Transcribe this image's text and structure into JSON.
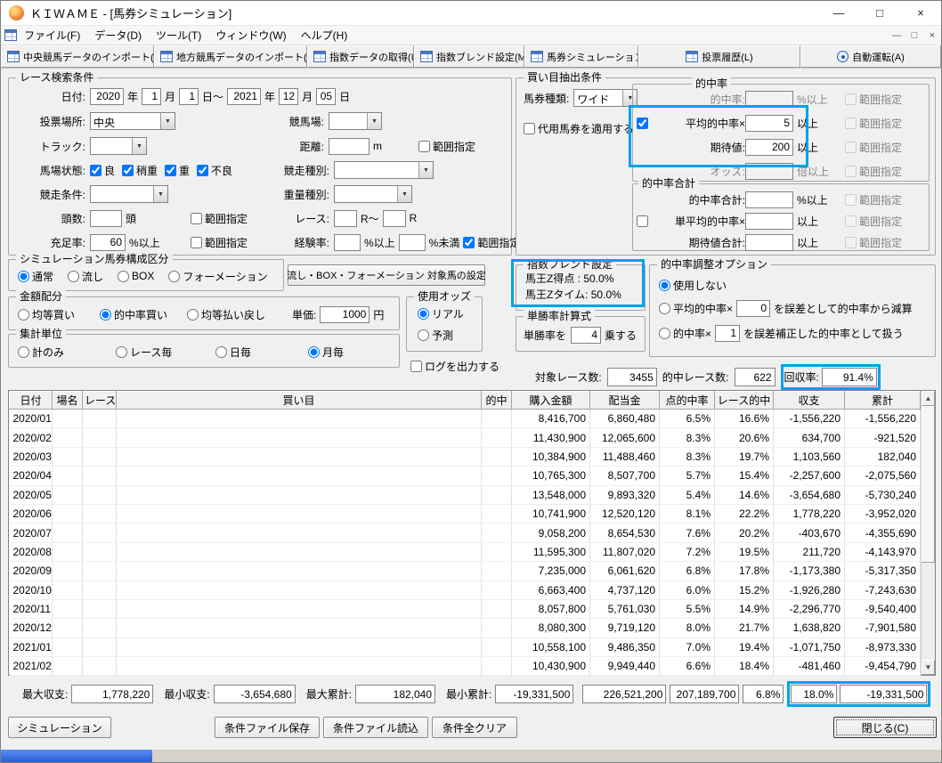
{
  "colors": {
    "annotation": "#00a2e8"
  },
  "icons": {
    "combo_arrow": "▼",
    "scroll_up": "▲",
    "scroll_down": "▼"
  },
  "titlebar": {
    "title": "ＫＩＷＡＭＥ - [馬券シミュレーション]",
    "minimize": "—",
    "maximize": "□",
    "close": "×"
  },
  "menubar": {
    "items": [
      "ファイル(F)",
      "データ(D)",
      "ツール(T)",
      "ウィンドウ(W)",
      "ヘルプ(H)"
    ],
    "mdi_minimize": "—",
    "mdi_restore": "□",
    "mdi_close": "×"
  },
  "toolbar": {
    "buttons": [
      "中央競馬データのインポート(J)",
      "地方競馬データのインポート(N)",
      "指数データの取得(I)",
      "指数ブレンド設定(M)",
      "馬券シミュレーション(B)",
      "投票履歴(L)",
      "自動運転(A)"
    ]
  },
  "race_search": {
    "legend": "レース検索条件",
    "date_label": "日付:",
    "date_from_year": "2020",
    "date_from_month": "1",
    "date_from_day": "1",
    "date_to_year": "2021",
    "date_to_month": "12",
    "date_to_day": "05",
    "unit_year": "年",
    "unit_month": "月",
    "unit_day_tilde": "日～",
    "unit_day": "日",
    "place_label": "投票場所:",
    "place_value": "中央",
    "course_label": "競馬場:",
    "track_label": "トラック:",
    "distance_label": "距離:",
    "distance_unit": "m",
    "ground_label": "馬場状態:",
    "ground_options": [
      {
        "label": "良",
        "checked": true
      },
      {
        "label": "稍重",
        "checked": true
      },
      {
        "label": "重",
        "checked": true
      },
      {
        "label": "不良",
        "checked": true
      }
    ],
    "race_type_label": "競走種別:",
    "race_cond_label": "競走条件:",
    "weight_type_label": "重量種別:",
    "heads_label": "頭数:",
    "heads_unit": "頭",
    "race_label": "レース:",
    "race_unit1": "R～",
    "race_unit2": "R",
    "fill_label": "充足率:",
    "fill_value": "60",
    "fill_unit": "%以上",
    "exp_label": "経験率:",
    "exp_unit1": "%以上",
    "exp_unit2": "%未満",
    "range_label": "範囲指定",
    "range_distance_checked": false,
    "range_heads_checked": false,
    "range_fill_checked": false,
    "range_exp_checked": true
  },
  "extract": {
    "legend": "買い目抽出条件",
    "ticket_label": "馬券種類:",
    "ticket_value": "ワイド",
    "substitute_label": "代用馬券を適用する",
    "substitute_checked": false,
    "range_label": "範囲指定",
    "hit_group_legend": "的中率",
    "hit_rate_label": "的中率:",
    "hit_rate_unit": "%以上",
    "avg_hit_label": "平均的中率×",
    "avg_hit_value": "5",
    "avg_hit_unit": "以上",
    "avg_hit_checked": true,
    "expect_label": "期待値:",
    "expect_value": "200",
    "expect_unit": "以上",
    "odds_label": "オッズ:",
    "odds_unit": "倍以上",
    "total_group_legend": "的中率合計",
    "hit_total_label": "的中率合計:",
    "hit_total_unit": "%以上",
    "avg_single_label": "単平均的中率×",
    "avg_single_unit": "以上",
    "avg_single_checked": false,
    "expect_total_label": "期待値合計:",
    "expect_total_unit": "以上"
  },
  "sim_type": {
    "legend": "シミュレーション馬券構成区分",
    "options": [
      {
        "label": "通常",
        "checked": true
      },
      {
        "label": "流し",
        "checked": false
      },
      {
        "label": "BOX",
        "checked": false
      },
      {
        "label": "フォーメーション",
        "checked": false
      }
    ]
  },
  "target_button_label": "流し・BOX・フォーメーション 対象馬の設定",
  "amount": {
    "legend": "金額配分",
    "options": [
      {
        "label": "均等買い",
        "checked": false
      },
      {
        "label": "的中率買い",
        "checked": true
      },
      {
        "label": "均等払い戻し",
        "checked": false
      }
    ],
    "unit_label": "単価:",
    "unit_value": "1000",
    "unit_suffix": "円"
  },
  "use_odds": {
    "legend": "使用オッズ",
    "options": [
      {
        "label": "リアル",
        "checked": true
      },
      {
        "label": "予測",
        "checked": false
      }
    ]
  },
  "aggregate": {
    "legend": "集計単位",
    "options": [
      {
        "label": "計のみ",
        "checked": false
      },
      {
        "label": "レース毎",
        "checked": false
      },
      {
        "label": "日毎",
        "checked": false
      },
      {
        "label": "月毎",
        "checked": true
      }
    ]
  },
  "log_label": "ログを出力する",
  "log_checked": false,
  "blend": {
    "legend": "指数ブレンド設定",
    "line1": "馬王Z得点 : 50.0%",
    "line2": "馬王Zタイム: 50.0%"
  },
  "win_calc": {
    "legend": "単勝率計算式",
    "prefix": "単勝率を",
    "value": "4",
    "suffix": "乗する"
  },
  "adjust": {
    "legend": "的中率調整オプション",
    "opt1_label": "使用しない",
    "opt1_checked": true,
    "opt2_label": "平均的中率×",
    "opt2_value": "0",
    "opt2_suffix": "を誤差として的中率から減算",
    "opt2_checked": false,
    "opt3_label": "的中率×",
    "opt3_value": "1",
    "opt3_suffix": "を誤差補正した的中率として扱う",
    "opt3_checked": false
  },
  "stats": {
    "target_label": "対象レース数:",
    "target_value": "3455",
    "hit_label": "的中レース数:",
    "hit_value": "622",
    "recovery_label": "回収率:",
    "recovery_value": "91.4%"
  },
  "table": {
    "headers": [
      "日付",
      "場名",
      "レース",
      "買い目",
      "的中",
      "購入金額",
      "配当金",
      "点的中率",
      "レース的中",
      "収支",
      "累計"
    ],
    "rows": [
      [
        "2020/01",
        "",
        "",
        "",
        "",
        "8,416,700",
        "6,860,480",
        "6.5%",
        "16.6%",
        "-1,556,220",
        "-1,556,220"
      ],
      [
        "2020/02",
        "",
        "",
        "",
        "",
        "11,430,900",
        "12,065,600",
        "8.3%",
        "20.6%",
        "634,700",
        "-921,520"
      ],
      [
        "2020/03",
        "",
        "",
        "",
        "",
        "10,384,900",
        "11,488,460",
        "8.3%",
        "19.7%",
        "1,103,560",
        "182,040"
      ],
      [
        "2020/04",
        "",
        "",
        "",
        "",
        "10,765,300",
        "8,507,700",
        "5.7%",
        "15.4%",
        "-2,257,600",
        "-2,075,560"
      ],
      [
        "2020/05",
        "",
        "",
        "",
        "",
        "13,548,000",
        "9,893,320",
        "5.4%",
        "14.6%",
        "-3,654,680",
        "-5,730,240"
      ],
      [
        "2020/06",
        "",
        "",
        "",
        "",
        "10,741,900",
        "12,520,120",
        "8.1%",
        "22.2%",
        "1,778,220",
        "-3,952,020"
      ],
      [
        "2020/07",
        "",
        "",
        "",
        "",
        "9,058,200",
        "8,654,530",
        "7.6%",
        "20.2%",
        "-403,670",
        "-4,355,690"
      ],
      [
        "2020/08",
        "",
        "",
        "",
        "",
        "11,595,300",
        "11,807,020",
        "7.2%",
        "19.5%",
        "211,720",
        "-4,143,970"
      ],
      [
        "2020/09",
        "",
        "",
        "",
        "",
        "7,235,000",
        "6,061,620",
        "6.8%",
        "17.8%",
        "-1,173,380",
        "-5,317,350"
      ],
      [
        "2020/10",
        "",
        "",
        "",
        "",
        "6,663,400",
        "4,737,120",
        "6.0%",
        "15.2%",
        "-1,926,280",
        "-7,243,630"
      ],
      [
        "2020/11",
        "",
        "",
        "",
        "",
        "8,057,800",
        "5,761,030",
        "5.5%",
        "14.9%",
        "-2,296,770",
        "-9,540,400"
      ],
      [
        "2020/12",
        "",
        "",
        "",
        "",
        "8,080,300",
        "9,719,120",
        "8.0%",
        "21.7%",
        "1,638,820",
        "-7,901,580"
      ],
      [
        "2021/01",
        "",
        "",
        "",
        "",
        "10,558,100",
        "9,486,350",
        "7.0%",
        "19.4%",
        "-1,071,750",
        "-8,973,330"
      ],
      [
        "2021/02",
        "",
        "",
        "",
        "",
        "10,430,900",
        "9,949,440",
        "6.6%",
        "18.4%",
        "-481,460",
        "-9,454,790"
      ]
    ]
  },
  "summary": {
    "max_balance_label": "最大収支:",
    "max_balance": "1,778,220",
    "min_balance_label": "最小収支:",
    "min_balance": "-3,654,680",
    "max_total_label": "最大累計:",
    "max_total": "182,040",
    "min_total_label": "最小累計:",
    "min_total": "-19,331,500",
    "total_purchase": "226,521,200",
    "total_payout": "207,189,700",
    "total_point_rate": "6.8%",
    "total_race_rate": "18.0%",
    "total_balance": "-19,331,500"
  },
  "actions": {
    "simulate": "シミュレーション",
    "save": "条件ファイル保存",
    "load": "条件ファイル読込",
    "clear": "条件全クリア",
    "close": "閉じる(C)"
  }
}
